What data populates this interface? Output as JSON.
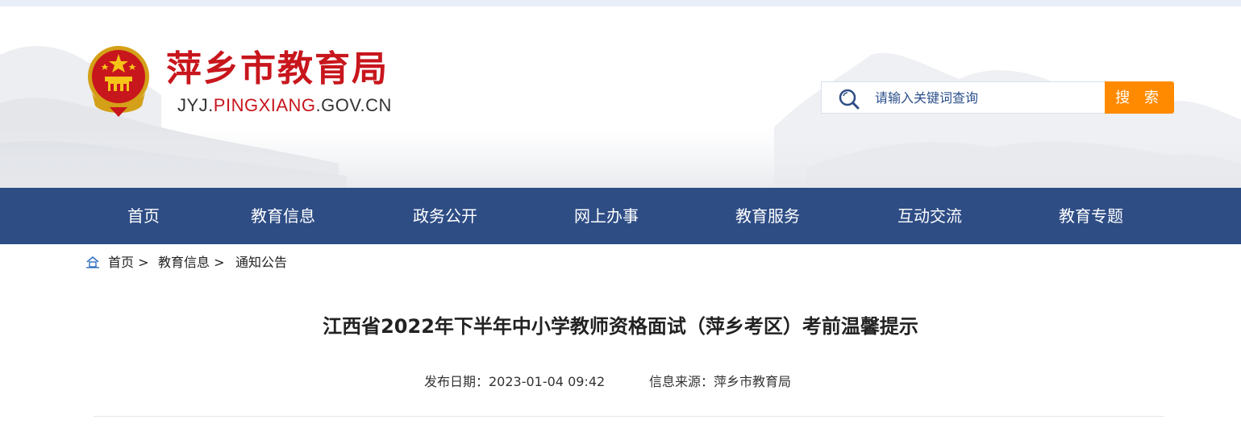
{
  "header": {
    "site_name": "萍乡市教育局",
    "domain_prefix": "JYJ.",
    "domain_highlight": "PINGXIANG",
    "domain_suffix": ".GOV.CN"
  },
  "search": {
    "placeholder": "请输入关键词查询",
    "button_label": "搜 索",
    "icon": "search-icon"
  },
  "nav": {
    "items": [
      {
        "label": "首页"
      },
      {
        "label": "教育信息"
      },
      {
        "label": "政务公开"
      },
      {
        "label": "网上办事"
      },
      {
        "label": "教育服务"
      },
      {
        "label": "互动交流"
      },
      {
        "label": "教育专题"
      }
    ]
  },
  "breadcrumb": {
    "icon": "home-icon",
    "items": [
      "首页 >",
      "教育信息 >",
      "通知公告"
    ]
  },
  "article": {
    "title": "江西省2022年下半年中小学教师资格面试（萍乡考区）考前温馨提示",
    "date": "发布日期：2023-01-04 09:42",
    "source": "信息来源：萍乡市教育局"
  },
  "colors": {
    "nav_bg": "#2e4d85",
    "brand_red": "#c8161d",
    "search_button": "#ff8a00"
  }
}
